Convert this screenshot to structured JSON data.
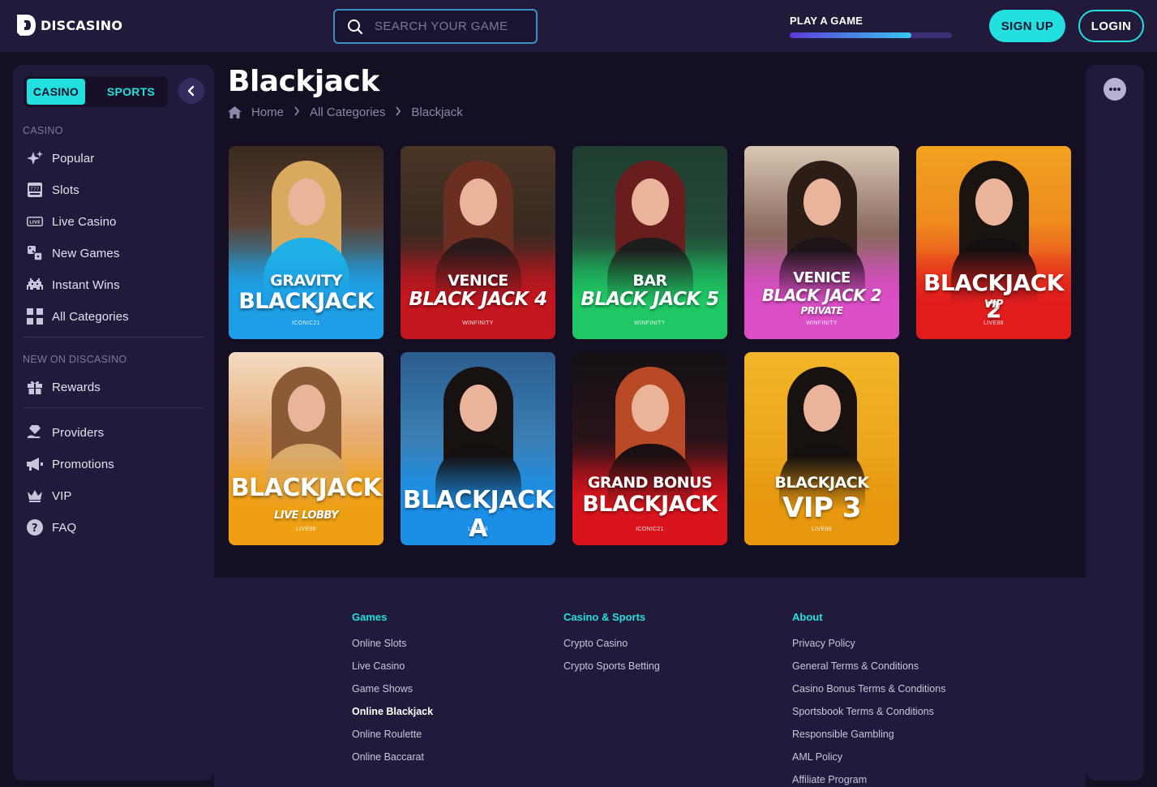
{
  "header": {
    "brand": "DISCASINO",
    "search_placeholder": "SEARCH YOUR GAME",
    "play_label": "PLAY A GAME",
    "play_progress_fraction": 0.75,
    "signup_label": "SIGN UP",
    "login_label": "LOGIN"
  },
  "sidebar": {
    "tab_casino": "CASINO",
    "tab_sports": "SPORTS",
    "section_casino": "CASINO",
    "casino_items": [
      {
        "label": "Popular",
        "icon": "sparkle-icon"
      },
      {
        "label": "Slots",
        "icon": "slot-machine-icon"
      },
      {
        "label": "Live Casino",
        "icon": "live-icon"
      },
      {
        "label": "New Games",
        "icon": "dice-icon"
      },
      {
        "label": "Instant Wins",
        "icon": "invader-icon"
      },
      {
        "label": "All Categories",
        "icon": "grid-icon"
      }
    ],
    "section_new": "NEW ON DISCASINO",
    "new_items": [
      {
        "label": "Rewards",
        "icon": "gift-icon"
      }
    ],
    "more_items": [
      {
        "label": "Providers",
        "icon": "diamond-hand-icon"
      },
      {
        "label": "Promotions",
        "icon": "megaphone-icon"
      },
      {
        "label": "VIP",
        "icon": "crown-icon"
      },
      {
        "label": "FAQ",
        "icon": "question-icon"
      }
    ]
  },
  "page": {
    "title": "Blackjack",
    "breadcrumb": [
      "Home",
      "All Categories",
      "Blackjack"
    ]
  },
  "games": [
    {
      "line1": "GRAVITY",
      "line2": "BLACKJACK",
      "line3": "",
      "provider": "ICONIC21",
      "theme": "blue"
    },
    {
      "line1": "VENICE",
      "line2": "BLACK JACK 4",
      "line3": "",
      "provider": "WINFINITY",
      "theme": "red"
    },
    {
      "line1": "BAR",
      "line2": "BLACK JACK 5",
      "line3": "",
      "provider": "WINFINITY",
      "theme": "green"
    },
    {
      "line1": "VENICE",
      "line2": "BLACK JACK 2",
      "line3": "PRIVATE",
      "provider": "WINFINITY",
      "theme": "pink"
    },
    {
      "line1": "",
      "line2": "BLACKJACK 2",
      "line3": "VIP",
      "provider": "LIVE88",
      "theme": "orange-red"
    },
    {
      "line1": "",
      "line2": "BLACKJACK",
      "line3": "LIVE LOBBY",
      "provider": "LIVE88",
      "theme": "amber"
    },
    {
      "line1": "",
      "line2": "BLACKJACK A",
      "line3": "",
      "provider": "LIVE88",
      "theme": "sky"
    },
    {
      "line1": "GRAND BONUS",
      "line2": "BLACKJACK",
      "line3": "",
      "provider": "ICONIC21",
      "theme": "crimson"
    },
    {
      "line1": "BLACKJACK",
      "line2": "VIP 3",
      "line3": "",
      "provider": "LIVE88",
      "theme": "gold"
    }
  ],
  "footer": {
    "columns": [
      {
        "heading": "Games",
        "links": [
          "Online Slots",
          "Live Casino",
          "Game Shows",
          "Online Blackjack",
          "Online Roulette",
          "Online Baccarat"
        ],
        "active": "Online Blackjack"
      },
      {
        "heading": "Casino & Sports",
        "links": [
          "Crypto Casino",
          "Crypto Sports Betting"
        ]
      },
      {
        "heading": "About",
        "links": [
          "Privacy Policy",
          "General Terms & Conditions",
          "Casino Bonus Terms & Conditions",
          "Sportsbook Terms & Conditions",
          "Responsible Gambling",
          "AML Policy",
          "Affiliate Program"
        ]
      }
    ]
  },
  "colors": {
    "accent": "#23e0e0",
    "panel": "#221a3a",
    "page": "#150f24"
  }
}
